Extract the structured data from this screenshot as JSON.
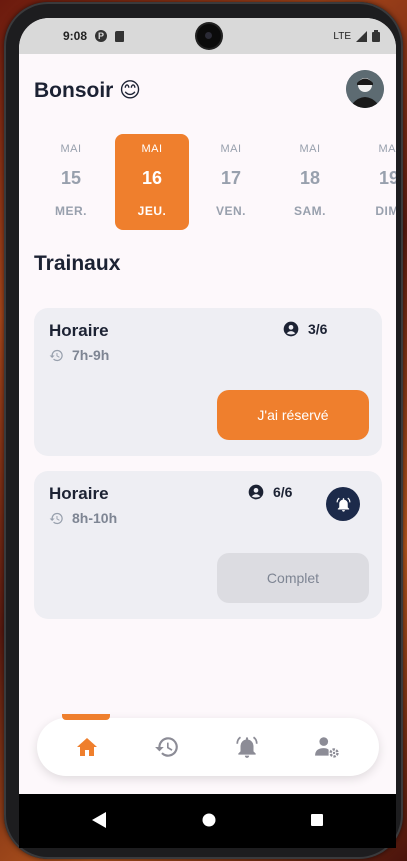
{
  "status_bar": {
    "time": "9:08",
    "app_icon_letter": "P",
    "network": "LTE"
  },
  "header": {
    "greeting": "Bonsoir 😊",
    "avatar_icon": "avatar-icon"
  },
  "days": [
    {
      "month": "MAI",
      "day": "15",
      "weekday": "MER.",
      "active": false
    },
    {
      "month": "MAI",
      "day": "16",
      "weekday": "JEU.",
      "active": true
    },
    {
      "month": "MAI",
      "day": "17",
      "weekday": "VEN.",
      "active": false
    },
    {
      "month": "MAI",
      "day": "18",
      "weekday": "SAM.",
      "active": false
    },
    {
      "month": "MAI",
      "day": "19",
      "weekday": "DIM.",
      "active": false
    }
  ],
  "section_title": "Trainaux",
  "slots": [
    {
      "label": "Horaire",
      "time": "7h-9h",
      "count": "3/6",
      "button": "J'ai réservé",
      "button_state": "primary",
      "has_bell": false
    },
    {
      "label": "Horaire",
      "time": "8h-10h",
      "count": "6/6",
      "button": "Complet",
      "button_state": "disabled",
      "has_bell": true
    }
  ],
  "nav": [
    {
      "icon": "home-icon",
      "active": true
    },
    {
      "icon": "history-icon",
      "active": false
    },
    {
      "icon": "bell-icon",
      "active": false
    },
    {
      "icon": "user-settings-icon",
      "active": false
    }
  ],
  "colors": {
    "accent": "#ef7f2d",
    "text_dark": "#1c2233",
    "text_muted": "#98a0ad",
    "card_bg": "#eeeef3",
    "bell_bg": "#1c2a4a"
  }
}
